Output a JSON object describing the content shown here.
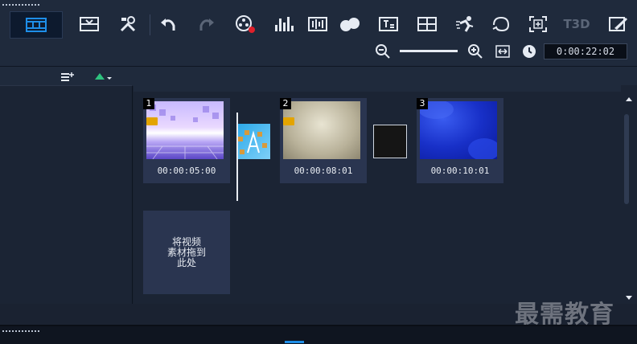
{
  "toolbar": {
    "buttons": [
      {
        "name": "storyboard-view-icon",
        "active": true
      },
      {
        "name": "import-icon"
      },
      {
        "name": "tools-icon"
      },
      {
        "name": "undo-icon"
      },
      {
        "name": "redo-icon"
      },
      {
        "name": "record-capture-icon"
      },
      {
        "name": "sound-mixer-icon"
      },
      {
        "name": "auto-music-icon"
      },
      {
        "name": "motion-tracking-icon"
      },
      {
        "name": "subtitle-editor-icon"
      },
      {
        "name": "multi-camera-icon"
      },
      {
        "name": "speed-ramp-icon"
      },
      {
        "name": "mask-creator-icon"
      },
      {
        "name": "pan-zoom-icon"
      },
      {
        "name": "3d-title-icon"
      },
      {
        "name": "painting-creator-icon"
      }
    ],
    "timecode": "0:00:22:02",
    "t3d_label": "T3D"
  },
  "clips": [
    {
      "number": "1",
      "duration": "00:00:05:00",
      "has_audio": true
    },
    {
      "number": "2",
      "duration": "00:00:08:01",
      "has_audio": true
    },
    {
      "number": "3",
      "duration": "00:00:10:01",
      "has_audio": false
    }
  ],
  "drop_zone": {
    "text": "将视频\n素材拖到\n此处"
  },
  "watermark": "最需教育",
  "colors": {
    "accent": "#1e8ee8",
    "speaker": "#e3a400",
    "play": "#2ec27e"
  }
}
